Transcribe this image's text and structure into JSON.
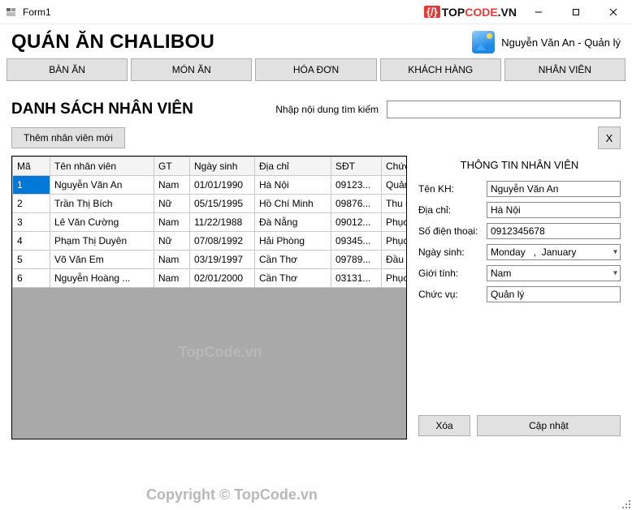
{
  "window": {
    "title": "Form1"
  },
  "brand": {
    "bracket": "{/}",
    "part1": "TOP",
    "part2": "CODE",
    "part3": ".VN"
  },
  "header": {
    "title": "QUÁN ĂN CHALIBOU",
    "user_label": "Nguyễn Văn An - Quản lý"
  },
  "nav": {
    "ban_an": "BÀN ĂN",
    "mon_an": "MÓN ĂN",
    "hoa_don": "HÓA ĐƠN",
    "khach_hang": "KHÁCH HÀNG",
    "nhan_vien": "NHÂN VIÊN"
  },
  "section": {
    "title": "DANH SÁCH NHÂN VIÊN",
    "search_label": "Nhập nội dung tìm kiếm"
  },
  "buttons": {
    "add_employee": "Thêm nhân viên mới",
    "close_panel": "X",
    "delete": "Xóa",
    "update": "Cập nhật"
  },
  "table": {
    "headers": {
      "ma": "Mã",
      "ten": "Tên nhân viên",
      "gt": "GT",
      "ngay_sinh": "Ngày sinh",
      "dia_chi": "Địa chỉ",
      "sdt": "SĐT",
      "chuc_vu": "Chức vụ"
    },
    "rows": [
      {
        "ma": "1",
        "ten": "Nguyễn Văn An",
        "gt": "Nam",
        "ngay_sinh": "01/01/1990",
        "dia_chi": "Hà Nội",
        "sdt": "09123...",
        "chuc_vu": "Quản lý"
      },
      {
        "ma": "2",
        "ten": "Trần Thị Bích",
        "gt": "Nữ",
        "ngay_sinh": "05/15/1995",
        "dia_chi": "Hồ Chí Minh",
        "sdt": "09876...",
        "chuc_vu": "Thu ngân"
      },
      {
        "ma": "3",
        "ten": "Lê Văn Cường",
        "gt": "Nam",
        "ngay_sinh": "11/22/1988",
        "dia_chi": "Đà Nẵng",
        "sdt": "09012...",
        "chuc_vu": "Phục vụ"
      },
      {
        "ma": "4",
        "ten": "Phạm Thị Duyên",
        "gt": "Nữ",
        "ngay_sinh": "07/08/1992",
        "dia_chi": "Hải Phòng",
        "sdt": "09345...",
        "chuc_vu": "Phục vụ"
      },
      {
        "ma": "5",
        "ten": "Võ Văn Em",
        "gt": "Nam",
        "ngay_sinh": "03/19/1997",
        "dia_chi": "Cần Thơ",
        "sdt": "09789...",
        "chuc_vu": "Đầu bếp"
      },
      {
        "ma": "6",
        "ten": "Nguyễn Hoàng ...",
        "gt": "Nam",
        "ngay_sinh": "02/01/2000",
        "dia_chi": "Cần Thơ",
        "sdt": "03131...",
        "chuc_vu": "Phục vụ"
      }
    ]
  },
  "detail": {
    "title": "THÔNG TIN NHÂN VIÊN",
    "labels": {
      "ten_kh": "Tên KH:",
      "dia_chi": "Địa chỉ:",
      "sdt": "Số điện thoại:",
      "ngay_sinh": "Ngày sinh:",
      "gioi_tinh": "Giới tính:",
      "chuc_vu": "Chức vụ:"
    },
    "values": {
      "ten_kh": "Nguyễn Văn An",
      "dia_chi": "Hà Nội",
      "sdt": "0912345678",
      "ngay_sinh": "Monday   ,  January   ",
      "gioi_tinh": "Nam",
      "chuc_vu": "Quản lý"
    }
  },
  "watermark": {
    "line1": "TopCode.vn",
    "line2": "Copyright © TopCode.vn"
  }
}
